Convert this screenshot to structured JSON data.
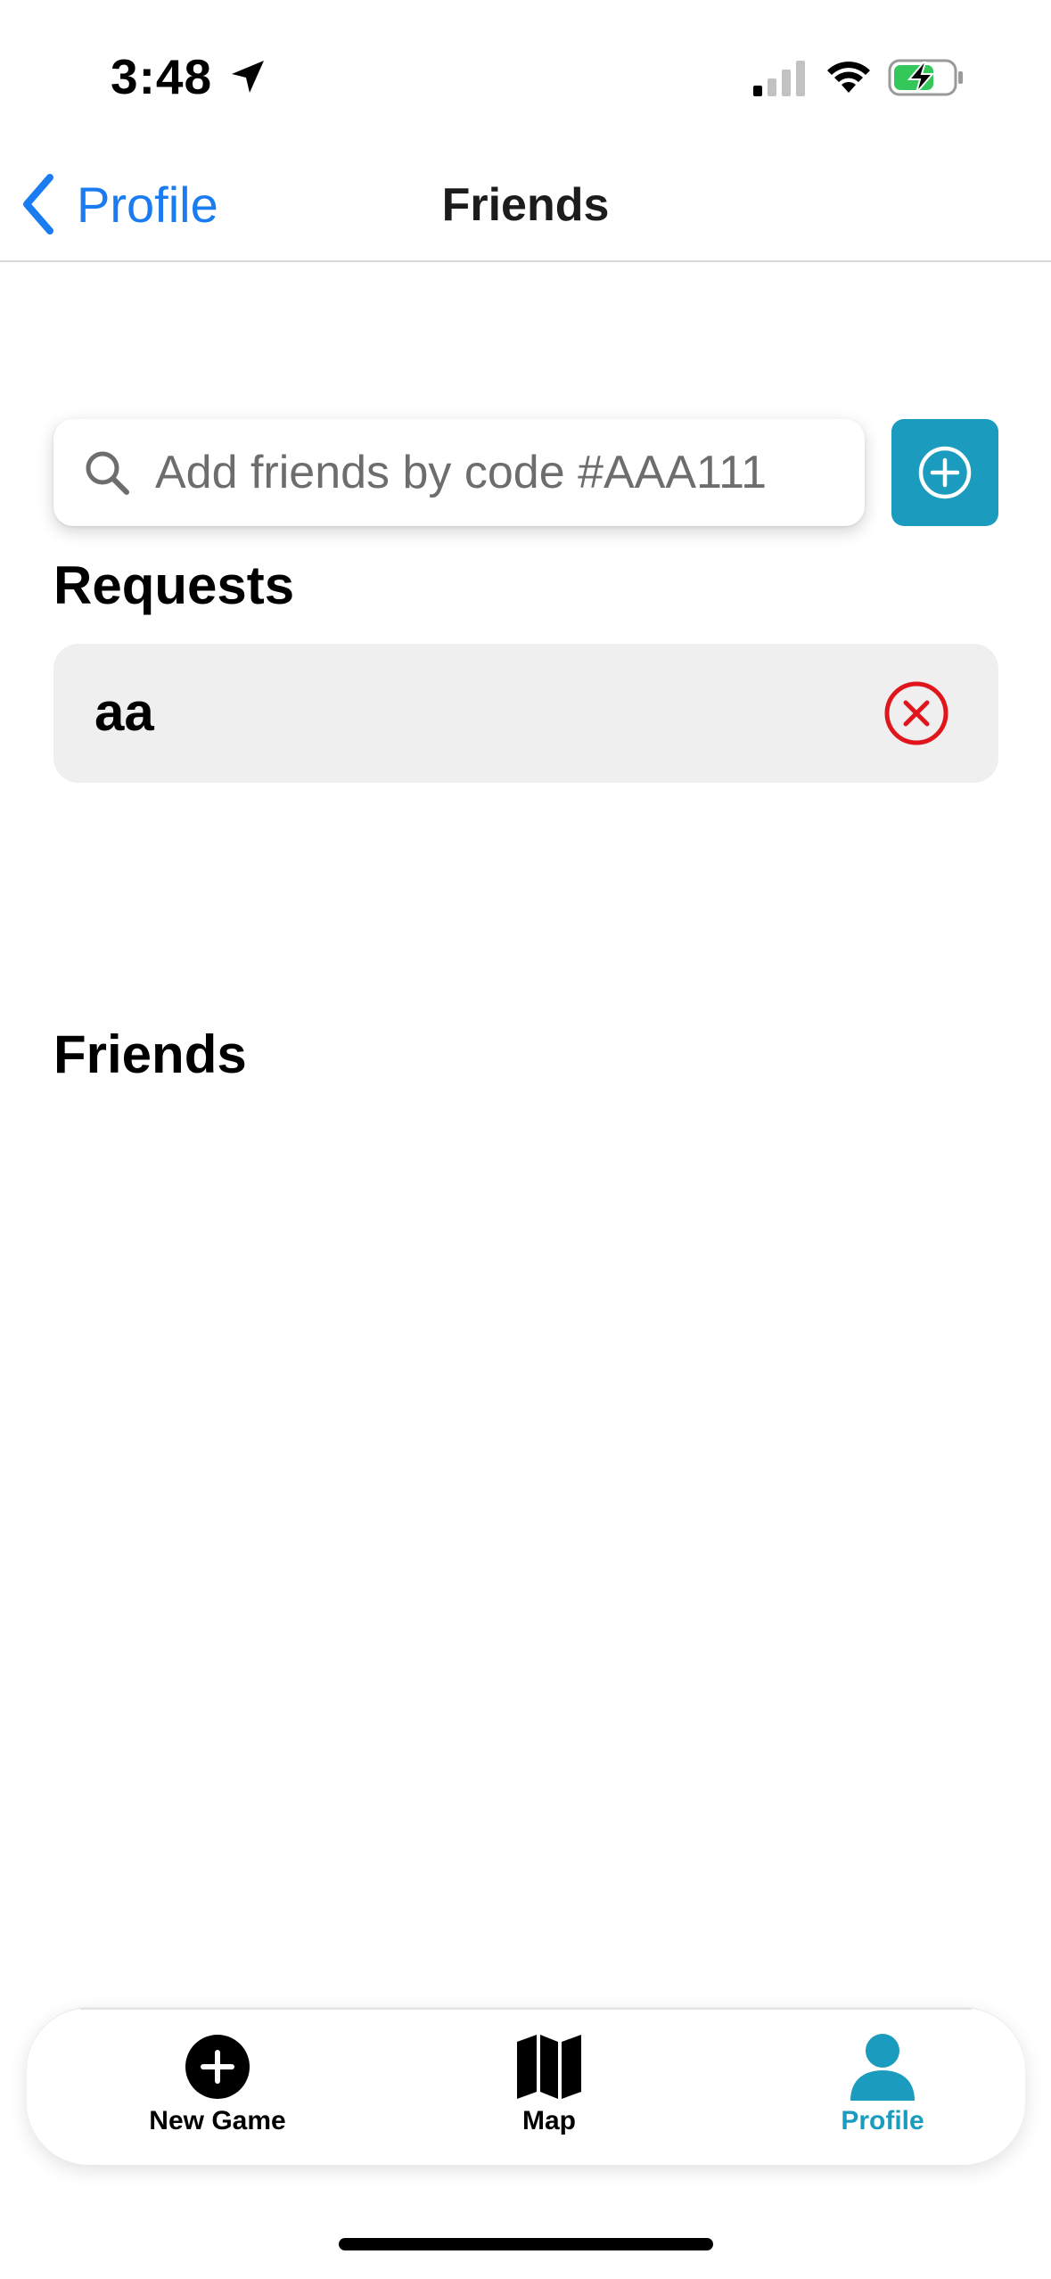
{
  "status_bar": {
    "time": "3:48",
    "icons": [
      "location-arrow-icon",
      "cellular-signal-icon",
      "wifi-icon",
      "battery-charging-icon"
    ]
  },
  "nav": {
    "back_label": "Profile",
    "title": "Friends"
  },
  "search": {
    "placeholder": "Add friends by code #AAA111",
    "value": ""
  },
  "sections": {
    "requests_heading": "Requests",
    "friends_heading": "Friends"
  },
  "requests": [
    {
      "name": "aa"
    }
  ],
  "friends": [],
  "tab_bar": {
    "items": [
      {
        "label": "New Game",
        "icon": "plus-circle-icon",
        "active": false
      },
      {
        "label": "Map",
        "icon": "map-icon",
        "active": false
      },
      {
        "label": "Profile",
        "icon": "person-icon",
        "active": true
      }
    ]
  },
  "colors": {
    "accent": "#1b9cbf",
    "link_blue": "#1a7cf0",
    "decline_red": "#e0161c",
    "row_background": "#efefef",
    "battery_green": "#34c759"
  }
}
